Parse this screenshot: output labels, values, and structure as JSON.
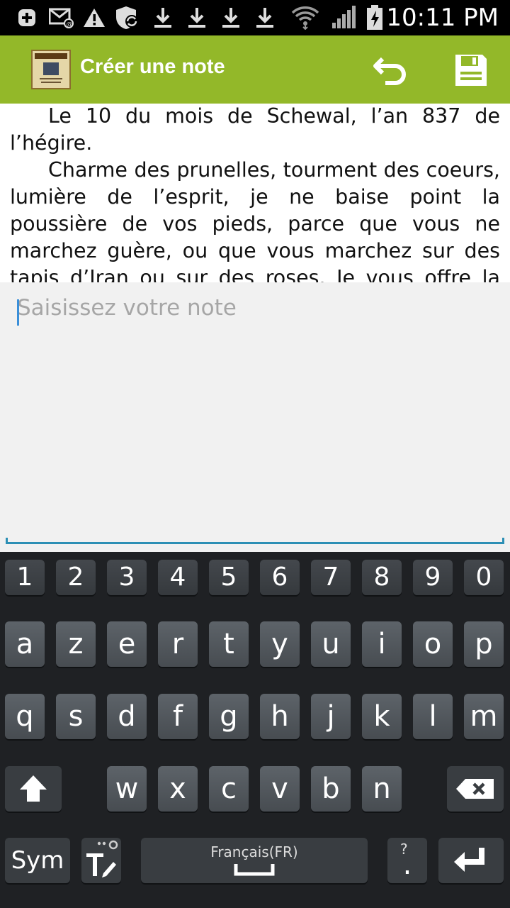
{
  "status_bar": {
    "time": "10:11 PM",
    "icons": [
      "plus-box-icon",
      "email-alert-icon",
      "warning-icon",
      "shield-sync-icon",
      "download-icon",
      "download-icon",
      "download-icon",
      "download-icon",
      "wifi-icon",
      "signal-icon",
      "battery-charging-icon"
    ]
  },
  "action_bar": {
    "title": "Créer une note",
    "logo_icon": "voltaire-book-cover-icon",
    "undo_icon": "undo-icon",
    "save_icon": "floppy-disk-icon",
    "accent": "#93b829"
  },
  "reader": {
    "paragraph_1": "Le 10 du mois de Schewal, l’an 837 de l’hégire.",
    "paragraph_2": "Charme des prunelles, tourment des coeurs, lumière de l’esprit, je ne baise point la poussière de vos pieds, parce que vous ne marchez guère, ou que vous marchez sur des tapis d’Iran ou sur des roses. Je vous offre la traduction d’un livre"
  },
  "note": {
    "value": "",
    "placeholder": "Saisissez votre note"
  },
  "keyboard": {
    "row_numbers": [
      "1",
      "2",
      "3",
      "4",
      "5",
      "6",
      "7",
      "8",
      "9",
      "0"
    ],
    "row_1": [
      "a",
      "z",
      "e",
      "r",
      "t",
      "y",
      "u",
      "i",
      "o",
      "p"
    ],
    "row_2": [
      "q",
      "s",
      "d",
      "f",
      "g",
      "h",
      "j",
      "k",
      "l",
      "m"
    ],
    "row_3": [
      "w",
      "x",
      "c",
      "v",
      "b",
      "n"
    ],
    "sym_label": "Sym",
    "space_label": "Français(FR)",
    "period_label": ".",
    "period_hint": "?",
    "shift_icon": "shift-arrow-icon",
    "backspace_icon": "backspace-icon",
    "enter_icon": "enter-icon",
    "handwriting_icon": "text-handwriting-icon"
  }
}
